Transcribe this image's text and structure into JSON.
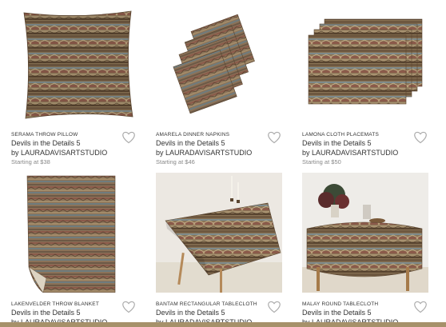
{
  "products": [
    {
      "category": "SERAMA THROW PILLOW",
      "design": "Devils in the Details 5",
      "artist": "by LAURADAVISARTSTUDIO",
      "price": "Starting at $38",
      "image": "throw-pillow"
    },
    {
      "category": "AMARELA DINNER NAPKINS",
      "design": "Devils in the Details 5",
      "artist": "by LAURADAVISARTSTUDIO",
      "price": "Starting at $46",
      "image": "dinner-napkins"
    },
    {
      "category": "LAMONA CLOTH PLACEMATS",
      "design": "Devils in the Details 5",
      "artist": "by LAURADAVISARTSTUDIO",
      "price": "Starting at $50",
      "image": "cloth-placemats"
    },
    {
      "category": "LAKENVELDER THROW BLANKET",
      "design": "Devils in the Details 5",
      "artist": "by LAURADAVISARTSTUDIO",
      "image": "throw-blanket"
    },
    {
      "category": "BANTAM RECTANGULAR TABLECLOTH",
      "design": "Devils in the Details 5",
      "artist": "by LAURADAVISARTSTUDIO",
      "image": "rectangular-tablecloth"
    },
    {
      "category": "MALAY ROUND TABLECLOTH",
      "design": "Devils in the Details 5",
      "artist": "by LAURADAVISARTSTUDIO",
      "image": "round-tablecloth"
    }
  ],
  "colors": {
    "fabric_base": "#8a7456",
    "fabric_dark": "#5a4530",
    "fabric_blue": "#7d8a8c",
    "fabric_red": "#8b5a4a",
    "heart_outline": "#aaaaaa",
    "bottom_bar": "#a6916a"
  },
  "icons": {
    "favorite": "heart-outline-icon"
  }
}
